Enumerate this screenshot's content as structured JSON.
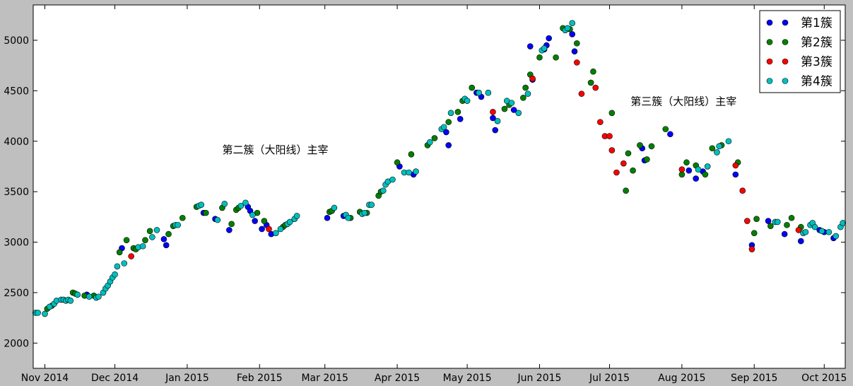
{
  "chart_data": {
    "type": "scatter",
    "x_axis": {
      "type": "date",
      "range": [
        "2014-10-27",
        "2015-10-10"
      ],
      "ticks": [
        {
          "date": "2014-11-01",
          "label": "Nov 2014"
        },
        {
          "date": "2014-12-01",
          "label": "Dec 2014"
        },
        {
          "date": "2015-01-01",
          "label": "Jan 2015"
        },
        {
          "date": "2015-02-01",
          "label": "Feb 2015"
        },
        {
          "date": "2015-03-01",
          "label": "Mar 2015"
        },
        {
          "date": "2015-04-01",
          "label": "Apr 2015"
        },
        {
          "date": "2015-05-01",
          "label": "May 2015"
        },
        {
          "date": "2015-06-01",
          "label": "Jun 2015"
        },
        {
          "date": "2015-07-01",
          "label": "Jul 2015"
        },
        {
          "date": "2015-08-01",
          "label": "Aug 2015"
        },
        {
          "date": "2015-09-01",
          "label": "Sep 2015"
        },
        {
          "date": "2015-10-01",
          "label": "Oct 2015"
        }
      ]
    },
    "y_axis": {
      "range": [
        1750,
        5350
      ],
      "ticks": [
        2000,
        2500,
        3000,
        3500,
        4000,
        4500,
        5000
      ]
    },
    "grid": false,
    "legend": {
      "position": "top-right"
    },
    "annotations": [
      {
        "text": "第二簇（大阳线）主宰",
        "x": "2015-01-16",
        "y": 3880
      },
      {
        "text": "第三簇（大阳线）主宰",
        "x": "2015-07-10",
        "y": 4360
      }
    ],
    "series": [
      {
        "name": "第1簇",
        "color": "#0000ff",
        "points": [
          [
            "2014-11-19",
            2480
          ],
          [
            "2014-12-04",
            2940
          ],
          [
            "2014-12-22",
            3030
          ],
          [
            "2014-12-23",
            2970
          ],
          [
            "2015-01-08",
            3290
          ],
          [
            "2015-01-13",
            3230
          ],
          [
            "2015-01-19",
            3120
          ],
          [
            "2015-01-27",
            3350
          ],
          [
            "2015-01-28",
            3310
          ],
          [
            "2015-01-30",
            3210
          ],
          [
            "2015-02-02",
            3130
          ],
          [
            "2015-02-04",
            3170
          ],
          [
            "2015-02-06",
            3080
          ],
          [
            "2015-03-02",
            3240
          ],
          [
            "2015-03-09",
            3260
          ],
          [
            "2015-04-02",
            3750
          ],
          [
            "2015-04-08",
            3670
          ],
          [
            "2015-04-23",
            3960
          ],
          [
            "2015-04-22",
            4090
          ],
          [
            "2015-04-28",
            4220
          ],
          [
            "2015-05-05",
            4480
          ],
          [
            "2015-05-07",
            4440
          ],
          [
            "2015-05-12",
            4230
          ],
          [
            "2015-05-13",
            4110
          ],
          [
            "2015-05-21",
            4310
          ],
          [
            "2015-05-28",
            4940
          ],
          [
            "2015-05-29",
            4610
          ],
          [
            "2015-06-03",
            4910
          ],
          [
            "2015-06-04",
            4950
          ],
          [
            "2015-06-05",
            5020
          ],
          [
            "2015-06-15",
            5060
          ],
          [
            "2015-06-16",
            4890
          ],
          [
            "2015-07-15",
            3930
          ],
          [
            "2015-07-16",
            3810
          ],
          [
            "2015-07-27",
            4070
          ],
          [
            "2015-08-04",
            3710
          ],
          [
            "2015-08-07",
            3630
          ],
          [
            "2015-08-10",
            3700
          ],
          [
            "2015-08-24",
            3670
          ],
          [
            "2015-08-31",
            2970
          ],
          [
            "2015-09-07",
            3210
          ],
          [
            "2015-09-14",
            3080
          ],
          [
            "2015-09-21",
            3010
          ],
          [
            "2015-09-29",
            3120
          ],
          [
            "2015-10-01",
            3100
          ],
          [
            "2015-10-05",
            3040
          ]
        ]
      },
      {
        "name": "第2簇",
        "color": "#008000",
        "points": [
          [
            "2014-11-02",
            2340
          ],
          [
            "2014-11-04",
            2370
          ],
          [
            "2014-11-13",
            2500
          ],
          [
            "2014-11-14",
            2490
          ],
          [
            "2014-11-18",
            2470
          ],
          [
            "2014-11-22",
            2470
          ],
          [
            "2014-12-03",
            2900
          ],
          [
            "2014-12-06",
            3020
          ],
          [
            "2014-12-09",
            2940
          ],
          [
            "2014-12-10",
            2930
          ],
          [
            "2014-12-14",
            3020
          ],
          [
            "2014-12-16",
            3110
          ],
          [
            "2014-12-24",
            3080
          ],
          [
            "2014-12-26",
            3160
          ],
          [
            "2014-12-30",
            3240
          ],
          [
            "2015-01-05",
            3350
          ],
          [
            "2015-01-09",
            3290
          ],
          [
            "2015-01-16",
            3340
          ],
          [
            "2015-01-20",
            3180
          ],
          [
            "2015-01-22",
            3320
          ],
          [
            "2015-01-23",
            3340
          ],
          [
            "2015-01-31",
            3290
          ],
          [
            "2015-02-03",
            3210
          ],
          [
            "2015-02-11",
            3150
          ],
          [
            "2015-02-12",
            3170
          ],
          [
            "2015-03-03",
            3300
          ],
          [
            "2015-03-04",
            3310
          ],
          [
            "2015-03-12",
            3240
          ],
          [
            "2015-03-16",
            3300
          ],
          [
            "2015-03-19",
            3290
          ],
          [
            "2015-03-24",
            3460
          ],
          [
            "2015-03-25",
            3500
          ],
          [
            "2015-04-01",
            3790
          ],
          [
            "2015-04-07",
            3870
          ],
          [
            "2015-04-14",
            3960
          ],
          [
            "2015-04-17",
            4030
          ],
          [
            "2015-04-23",
            4190
          ],
          [
            "2015-04-27",
            4290
          ],
          [
            "2015-04-29",
            4400
          ],
          [
            "2015-05-03",
            4530
          ],
          [
            "2015-05-17",
            4320
          ],
          [
            "2015-05-19",
            4360
          ],
          [
            "2015-05-25",
            4430
          ],
          [
            "2015-05-26",
            4530
          ],
          [
            "2015-05-28",
            4660
          ],
          [
            "2015-06-01",
            4830
          ],
          [
            "2015-06-08",
            4830
          ],
          [
            "2015-06-11",
            5120
          ],
          [
            "2015-06-14",
            5110
          ],
          [
            "2015-06-17",
            4970
          ],
          [
            "2015-06-23",
            4580
          ],
          [
            "2015-06-24",
            4690
          ],
          [
            "2015-07-02",
            4280
          ],
          [
            "2015-07-08",
            3510
          ],
          [
            "2015-07-09",
            3880
          ],
          [
            "2015-07-11",
            3710
          ],
          [
            "2015-07-14",
            3960
          ],
          [
            "2015-07-17",
            3820
          ],
          [
            "2015-07-19",
            3950
          ],
          [
            "2015-07-25",
            4120
          ],
          [
            "2015-08-01",
            3670
          ],
          [
            "2015-08-03",
            3790
          ],
          [
            "2015-08-07",
            3760
          ],
          [
            "2015-08-11",
            3670
          ],
          [
            "2015-08-14",
            3930
          ],
          [
            "2015-08-18",
            3960
          ],
          [
            "2015-08-25",
            3790
          ],
          [
            "2015-09-01",
            3090
          ],
          [
            "2015-09-02",
            3230
          ],
          [
            "2015-09-08",
            3160
          ],
          [
            "2015-09-15",
            3170
          ],
          [
            "2015-09-17",
            3240
          ],
          [
            "2015-09-21",
            3150
          ]
        ]
      },
      {
        "name": "第3簇",
        "color": "#ff0000",
        "points": [
          [
            "2014-12-08",
            2860
          ],
          [
            "2015-02-05",
            3130
          ],
          [
            "2015-05-12",
            4290
          ],
          [
            "2015-05-29",
            4620
          ],
          [
            "2015-06-17",
            4780
          ],
          [
            "2015-06-19",
            4470
          ],
          [
            "2015-06-25",
            4530
          ],
          [
            "2015-06-27",
            4190
          ],
          [
            "2015-06-29",
            4050
          ],
          [
            "2015-07-01",
            4050
          ],
          [
            "2015-07-02",
            3910
          ],
          [
            "2015-07-04",
            3690
          ],
          [
            "2015-07-07",
            3780
          ],
          [
            "2015-08-01",
            3720
          ],
          [
            "2015-08-24",
            3760
          ],
          [
            "2015-08-27",
            3510
          ],
          [
            "2015-08-29",
            3210
          ],
          [
            "2015-08-31",
            2930
          ],
          [
            "2015-09-20",
            3120
          ]
        ]
      },
      {
        "name": "第4簇",
        "color": "#00bfbf",
        "points": [
          [
            "2014-10-28",
            2300
          ],
          [
            "2014-10-29",
            2300
          ],
          [
            "2014-11-01",
            2290
          ],
          [
            "2014-11-03",
            2360
          ],
          [
            "2014-11-05",
            2390
          ],
          [
            "2014-11-06",
            2420
          ],
          [
            "2014-11-08",
            2430
          ],
          [
            "2014-11-09",
            2430
          ],
          [
            "2014-11-10",
            2420
          ],
          [
            "2014-11-11",
            2430
          ],
          [
            "2014-11-12",
            2420
          ],
          [
            "2014-11-15",
            2480
          ],
          [
            "2014-11-20",
            2460
          ],
          [
            "2014-11-23",
            2450
          ],
          [
            "2014-11-24",
            2460
          ],
          [
            "2014-11-26",
            2500
          ],
          [
            "2014-11-27",
            2540
          ],
          [
            "2014-11-28",
            2570
          ],
          [
            "2014-11-29",
            2610
          ],
          [
            "2014-11-30",
            2650
          ],
          [
            "2014-12-01",
            2680
          ],
          [
            "2014-12-02",
            2760
          ],
          [
            "2014-12-05",
            2790
          ],
          [
            "2014-12-11",
            2950
          ],
          [
            "2014-12-13",
            2960
          ],
          [
            "2014-12-17",
            3050
          ],
          [
            "2014-12-19",
            3120
          ],
          [
            "2014-12-27",
            3170
          ],
          [
            "2014-12-28",
            3170
          ],
          [
            "2015-01-06",
            3360
          ],
          [
            "2015-01-07",
            3370
          ],
          [
            "2015-01-14",
            3220
          ],
          [
            "2015-01-17",
            3380
          ],
          [
            "2015-01-24",
            3360
          ],
          [
            "2015-01-26",
            3390
          ],
          [
            "2015-01-29",
            3270
          ],
          [
            "2015-02-08",
            3090
          ],
          [
            "2015-02-10",
            3130
          ],
          [
            "2015-02-13",
            3180
          ],
          [
            "2015-02-14",
            3200
          ],
          [
            "2015-02-16",
            3230
          ],
          [
            "2015-02-17",
            3260
          ],
          [
            "2015-03-05",
            3340
          ],
          [
            "2015-03-10",
            3270
          ],
          [
            "2015-03-11",
            3240
          ],
          [
            "2015-03-17",
            3280
          ],
          [
            "2015-03-18",
            3290
          ],
          [
            "2015-03-20",
            3370
          ],
          [
            "2015-03-21",
            3370
          ],
          [
            "2015-03-26",
            3510
          ],
          [
            "2015-03-27",
            3570
          ],
          [
            "2015-03-28",
            3600
          ],
          [
            "2015-03-30",
            3620
          ],
          [
            "2015-04-04",
            3690
          ],
          [
            "2015-04-06",
            3690
          ],
          [
            "2015-04-09",
            3700
          ],
          [
            "2015-04-15",
            3990
          ],
          [
            "2015-04-20",
            4120
          ],
          [
            "2015-04-21",
            4140
          ],
          [
            "2015-04-24",
            4280
          ],
          [
            "2015-04-30",
            4420
          ],
          [
            "2015-05-01",
            4400
          ],
          [
            "2015-05-06",
            4480
          ],
          [
            "2015-05-10",
            4480
          ],
          [
            "2015-05-14",
            4200
          ],
          [
            "2015-05-18",
            4400
          ],
          [
            "2015-05-20",
            4380
          ],
          [
            "2015-05-23",
            4280
          ],
          [
            "2015-05-27",
            4470
          ],
          [
            "2015-06-02",
            4900
          ],
          [
            "2015-06-03",
            4920
          ],
          [
            "2015-06-12",
            5100
          ],
          [
            "2015-06-13",
            5120
          ],
          [
            "2015-06-15",
            5170
          ],
          [
            "2015-08-08",
            3720
          ],
          [
            "2015-08-12",
            3750
          ],
          [
            "2015-08-16",
            3890
          ],
          [
            "2015-08-17",
            3950
          ],
          [
            "2015-08-21",
            4000
          ],
          [
            "2015-09-10",
            3200
          ],
          [
            "2015-09-11",
            3200
          ],
          [
            "2015-09-22",
            3090
          ],
          [
            "2015-09-23",
            3100
          ],
          [
            "2015-09-25",
            3170
          ],
          [
            "2015-09-26",
            3190
          ],
          [
            "2015-09-27",
            3150
          ],
          [
            "2015-09-30",
            3110
          ],
          [
            "2015-10-03",
            3100
          ],
          [
            "2015-10-06",
            3060
          ],
          [
            "2015-10-08",
            3150
          ],
          [
            "2015-10-09",
            3190
          ]
        ]
      }
    ]
  }
}
